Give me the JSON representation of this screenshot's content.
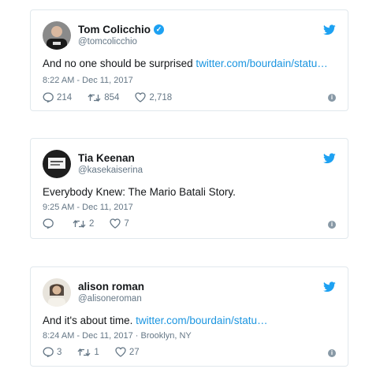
{
  "tweets": [
    {
      "name": "Tom Colicchio",
      "verified": true,
      "handle": "@tomcolicchio",
      "text": "And no one should be surprised ",
      "link": "twitter.com/bourdain/statu…",
      "time": "8:22 AM - Dec 11, 2017",
      "replies": "214",
      "retweets": "854",
      "likes": "2,718"
    },
    {
      "name": "Tia Keenan",
      "verified": false,
      "handle": "@kasekaiserina",
      "text": "Everybody Knew: The Mario Batali Story.",
      "link": "",
      "time": "9:25 AM - Dec 11, 2017",
      "replies": "",
      "retweets": "2",
      "likes": "7"
    },
    {
      "name": "alison roman",
      "verified": false,
      "handle": "@alisoneroman",
      "text": "And it's about time. ",
      "link": "twitter.com/bourdain/statu…",
      "time": "8:24 AM - Dec 11, 2017 · Brooklyn, NY",
      "replies": "3",
      "retweets": "1",
      "likes": "27"
    }
  ],
  "icons": {
    "brand": "twitter-bird-icon",
    "reply": "reply-icon",
    "retweet": "retweet-icon",
    "like": "heart-icon",
    "info": "info-icon",
    "verified": "verified-badge-icon"
  },
  "colors": {
    "accent": "#1da1f2",
    "link": "#1b95e0",
    "muted": "#657786",
    "border": "#e1e8ed"
  }
}
